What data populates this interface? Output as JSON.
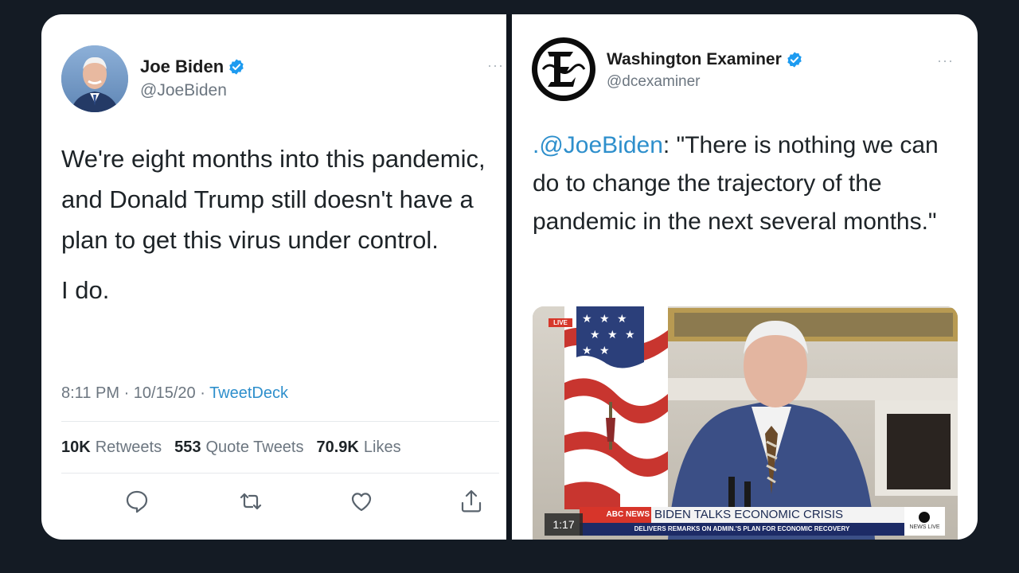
{
  "left_tweet": {
    "display_name": "Joe Biden",
    "handle": "@JoeBiden",
    "more": "···",
    "paragraph1": "We're eight months into this pandemic, and Donald Trump still doesn't have a plan to get this virus under control.",
    "paragraph2": "I do.",
    "time": "8:11 PM",
    "date": "10/15/20",
    "source": "TweetDeck",
    "stats": {
      "retweets_count": "10K",
      "retweets_label": "Retweets",
      "quotes_count": "553",
      "quotes_label": "Quote Tweets",
      "likes_count": "70.9K",
      "likes_label": "Likes"
    },
    "actions": [
      "reply-icon",
      "retweet-icon",
      "like-icon",
      "share-icon"
    ]
  },
  "right_tweet": {
    "display_name": "Washington Examiner",
    "handle": "@dcexaminer",
    "more": "···",
    "mention": ".@JoeBiden",
    "quote": ": \"There is nothing we can do to change the trajectory of the pandemic in the next several months.\"",
    "video": {
      "live_label": "LIVE",
      "time": "1:17",
      "news_tag": "ABC NEWS",
      "headline": "BIDEN TALKS ECONOMIC CRISIS",
      "subhead": "DELIVERS REMARKS ON ADMIN.'S PLAN FOR ECONOMIC RECOVERY",
      "network": "NEWS LIVE"
    }
  },
  "colors": {
    "background": "#141b24",
    "card": "#ffffff",
    "link": "#2e8fcc",
    "verified": "#1d9bf0",
    "text": "#1d2327",
    "muted": "#6c7680"
  }
}
